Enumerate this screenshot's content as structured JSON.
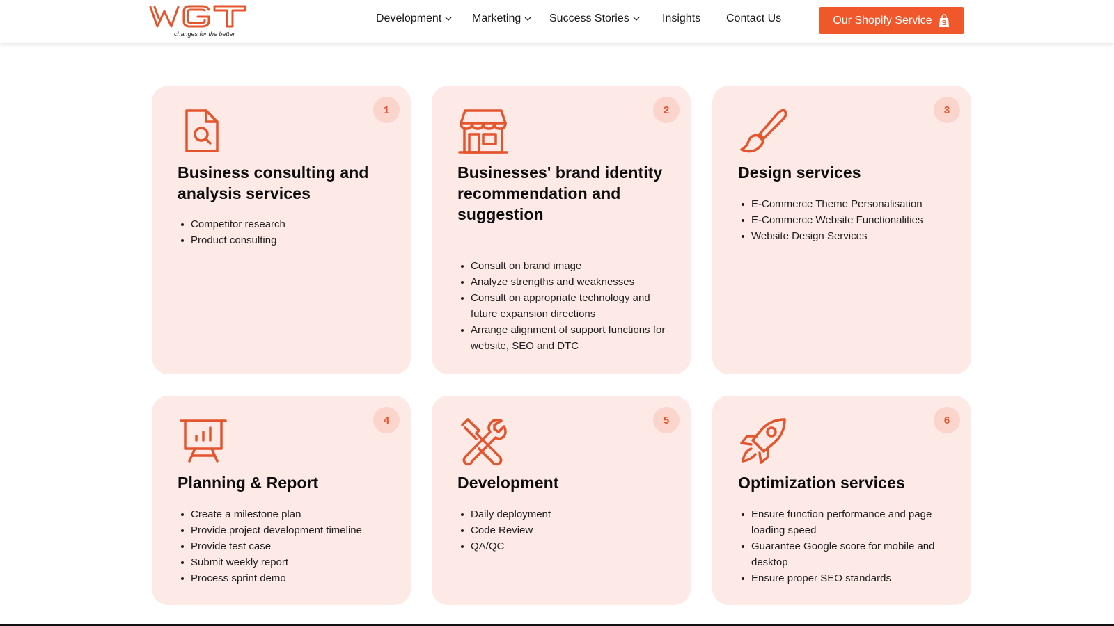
{
  "header": {
    "logo_text": "WGT",
    "logo_tagline": "changes for the better",
    "nav": [
      {
        "label": "Development",
        "dropdown": true,
        "icon": "chevron-down-icon"
      },
      {
        "label": "Marketing",
        "dropdown": true,
        "icon": "chevron-down-icon"
      },
      {
        "label": "Success Stories",
        "dropdown": true,
        "icon": "chevron-down-icon"
      },
      {
        "label": "Insights",
        "dropdown": false
      },
      {
        "label": "Contact Us",
        "dropdown": false
      }
    ],
    "cta": {
      "label": "Our Shopify Service",
      "icon": "shopify-bag-icon"
    }
  },
  "colors": {
    "accent": "#f0572a",
    "card_bg": "#fde9e6",
    "badge_bg": "#fbd4cb",
    "icon": "#e4552d"
  },
  "cards": [
    {
      "number": "1",
      "icon": "document-search-icon",
      "title": "Business consulting and analysis services",
      "items": [
        "Competitor research",
        "Product consulting"
      ]
    },
    {
      "number": "2",
      "icon": "storefront-icon",
      "title": "Businesses' brand identity recommendation and suggestion",
      "items": [
        "Consult on brand image",
        "Analyze strengths and weaknesses",
        "Consult on appropriate technology and future expansion directions",
        "Arrange alignment of support functions for website, SEO and DTC"
      ]
    },
    {
      "number": "3",
      "icon": "paint-brush-icon",
      "title": "Design services",
      "items": [
        "E-Commerce Theme Personalisation",
        "E-Commerce Website Functionalities",
        "Website Design Services"
      ]
    },
    {
      "number": "4",
      "icon": "presentation-chart-icon",
      "title": "Planning & Report",
      "items": [
        "Create a milestone plan",
        "Provide project development timeline",
        "Provide test case",
        "Submit weekly report",
        "Process sprint demo"
      ]
    },
    {
      "number": "5",
      "icon": "tools-icon",
      "title": "Development",
      "items": [
        "Daily deployment",
        "Code Review",
        "QA/QC"
      ]
    },
    {
      "number": "6",
      "icon": "rocket-icon",
      "title": "Optimization services",
      "items": [
        "Ensure function performance and page loading speed",
        "Guarantee Google score for mobile and desktop",
        "Ensure proper SEO standards"
      ]
    }
  ]
}
